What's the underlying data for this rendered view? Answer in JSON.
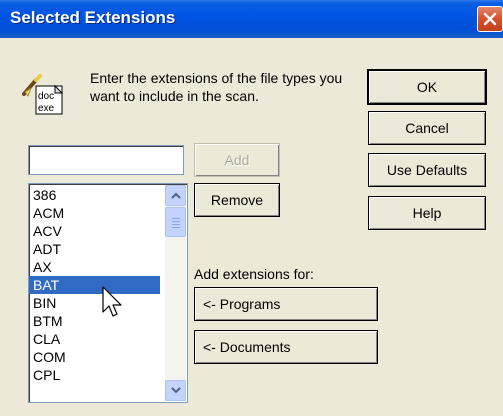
{
  "window": {
    "title": "Selected Extensions"
  },
  "intro": {
    "icon": "doc-exe-wand-icon",
    "icon_labels": [
      "doc",
      "exe"
    ],
    "text": "Enter the extensions of the file types you want to include in the scan."
  },
  "input": {
    "value": ""
  },
  "buttons": {
    "ok": "OK",
    "cancel": "Cancel",
    "use_defaults": "Use Defaults",
    "help": "Help",
    "add": "Add",
    "remove": "Remove",
    "programs": "<- Programs",
    "documents": "<- Documents"
  },
  "add_for_label": "Add extensions for:",
  "extensions": {
    "items": [
      "386",
      "ACM",
      "ACV",
      "ADT",
      "AX",
      "BAT",
      "BIN",
      "BTM",
      "CLA",
      "COM",
      "CPL"
    ],
    "selected": "BAT"
  },
  "colors": {
    "selection": "#316ac5",
    "titlebar": "#0054e3",
    "close": "#d9532f"
  }
}
